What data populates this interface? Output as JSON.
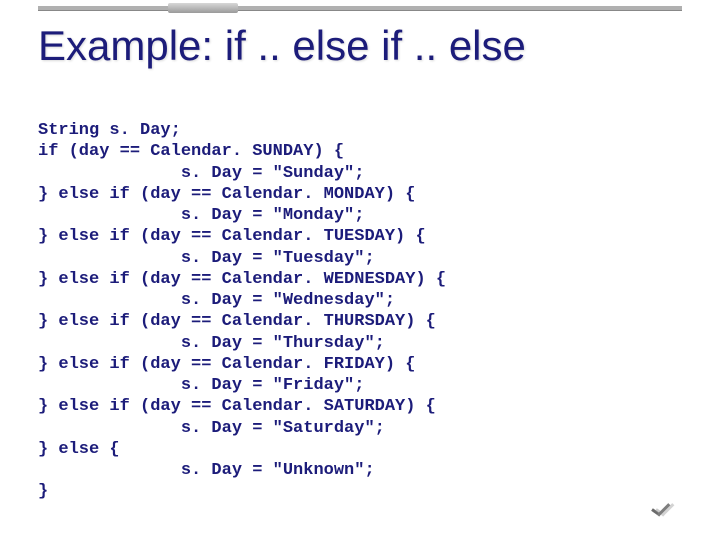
{
  "slide": {
    "title": "Example: if .. else if .. else"
  },
  "code": {
    "lines": [
      "String s. Day;",
      "if (day == Calendar. SUNDAY) {",
      "              s. Day = \"Sunday\";",
      "} else if (day == Calendar. MONDAY) {",
      "              s. Day = \"Monday\";",
      "} else if (day == Calendar. TUESDAY) {",
      "              s. Day = \"Tuesday\";",
      "} else if (day == Calendar. WEDNESDAY) {",
      "              s. Day = \"Wednesday\";",
      "} else if (day == Calendar. THURSDAY) {",
      "              s. Day = \"Thursday\";",
      "} else if (day == Calendar. FRIDAY) {",
      "              s. Day = \"Friday\";",
      "} else if (day == Calendar. SATURDAY) {",
      "              s. Day = \"Saturday\";",
      "} else {",
      "              s. Day = \"Unknown\";",
      "}"
    ]
  }
}
